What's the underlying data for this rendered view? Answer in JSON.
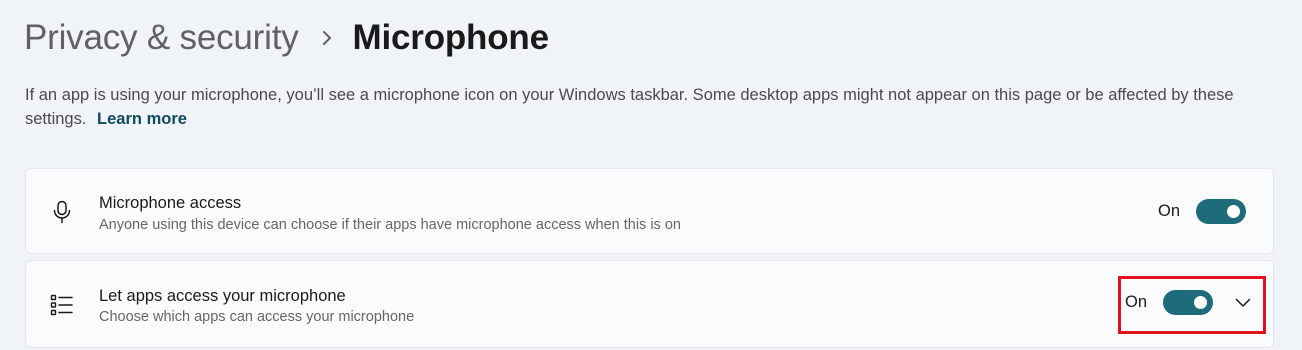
{
  "breadcrumb": {
    "parent": "Privacy & security",
    "separator_icon": "chevron-right-icon",
    "current": "Microphone"
  },
  "description": {
    "text": "If an app is using your microphone, you’ll see a microphone icon on your Windows taskbar. Some desktop apps might not appear on this page or be affected by these settings.",
    "link_label": "Learn more"
  },
  "settings": [
    {
      "icon": "microphone-icon",
      "title": "Microphone access",
      "subtitle": "Anyone using this device can choose if their apps have microphone access when this is on",
      "state_label": "On",
      "toggled": true
    },
    {
      "icon": "app-list-icon",
      "title": "Let apps access your microphone",
      "subtitle": "Choose which apps can access your microphone",
      "state_label": "On",
      "toggled": true,
      "expand_icon": "chevron-down-icon"
    }
  ],
  "colors": {
    "background": "#f0f4f9",
    "card": "#f9fbfd",
    "toggle_on": "#1e6b7b",
    "link": "#0f4a5e",
    "highlight": "#e0121b"
  }
}
